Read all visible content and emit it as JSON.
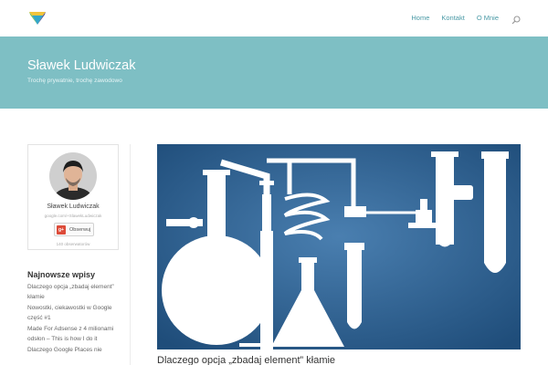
{
  "header": {
    "logo_icon": "diamond-logo-icon",
    "nav": [
      {
        "label": "Home"
      },
      {
        "label": "Kontakt"
      },
      {
        "label": "O Mnie"
      }
    ],
    "search_icon": "search-icon",
    "accent_color": "#4a9aa6"
  },
  "hero": {
    "title": "Sławek Ludwiczak",
    "tagline": "Trochę prywatnie, trochę zawodowo",
    "background_color": "#7ebfc4"
  },
  "sidebar": {
    "profile": {
      "name": "Sławek Ludwiczak",
      "url": "google.com/+SlawekLudwiczak",
      "follow_label": "Obserwuj",
      "followers": "140 obserwatorów"
    },
    "recent_posts_title": "Najnowsze wpisy",
    "recent_posts": [
      "Dlaczego opcja „zbadaj element” kłamie",
      "Nowostki, ciekawostki w Google część #1",
      "Made For Adsense z 4 milionami odsłon – This is how I do it",
      "Dlaczego Google Places nie"
    ]
  },
  "main": {
    "featured_image_icon": "chemistry-lab-illustration",
    "post_title": "Dlaczego opcja „zbadaj element” kłamie"
  }
}
